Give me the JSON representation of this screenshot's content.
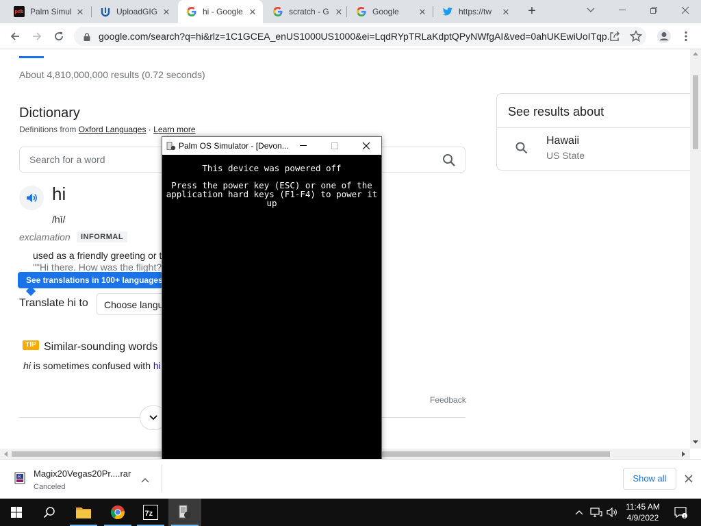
{
  "browser": {
    "tabs": [
      {
        "title": "Palm Simul",
        "favicon": "pdb-icon",
        "active": false
      },
      {
        "title": "UploadGIG",
        "favicon": "upload-gig-icon",
        "active": false
      },
      {
        "title": "hi - Google",
        "favicon": "google-icon",
        "active": true
      },
      {
        "title": "scratch - G",
        "favicon": "google-icon",
        "active": false
      },
      {
        "title": "Google",
        "favicon": "google-icon",
        "active": false
      },
      {
        "title": "https://tw",
        "favicon": "twitter-icon",
        "active": false
      }
    ],
    "new_tab": "+",
    "url": "google.com/search?q=hi&rlz=1C1GCEA_enUS1000US1000&ei=LqdRYpTRLaKdptQPyNWfgAI&ved=0ahUKEwiUoITqp..."
  },
  "results": {
    "stats": "About 4,810,000,000 results (0.72 seconds)"
  },
  "dictionary": {
    "title": "Dictionary",
    "source_prefix": "Definitions from",
    "source_link": "Oxford Languages",
    "separator": " · ",
    "learn_more": "Learn more",
    "search_placeholder": "Search for a word",
    "word": "hi",
    "phonetic": "/hī/",
    "part_of_speech": "exclamation",
    "register": "INFORMAL",
    "definition": "used as a friendly greeting or t",
    "example": "\"\"Hi there. How was the flight?\"",
    "translations_button": "See translations in 100+ languages",
    "translate_label": "Translate hi to",
    "choose_language": "Choose langu",
    "tip_badge": "TIP",
    "similar_heading": "Similar-sounding words",
    "confused_word": "hi",
    "confused_text": " is sometimes confused with ",
    "confused_link": "hi",
    "feedback": "Feedback"
  },
  "knowledge_panel": {
    "heading": "See results about",
    "name": "Hawaii",
    "subtitle": "US State"
  },
  "palm_window": {
    "title": "Palm OS Simulator - [Devon...",
    "line1": "This device was powered off",
    "line2": "Press the power key (ESC) or one of the application hard keys (F1-F4) to power it up"
  },
  "downloads": {
    "filename": "Magix20Vegas20Pr....rar",
    "status": "Canceled",
    "show_all": "Show all"
  },
  "taskbar": {
    "apps": [
      "file-explorer-icon",
      "chrome-icon",
      "7zip-icon",
      "palm-simulator-icon"
    ],
    "time": "11:45 AM",
    "date": "4/9/2022"
  },
  "colors": {
    "accent": "#1a73e8",
    "tip": "#f9ab00",
    "link": "#1a0dab"
  }
}
